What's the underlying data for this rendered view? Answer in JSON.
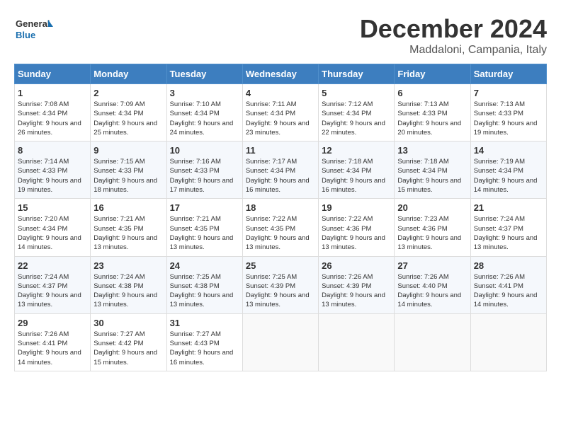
{
  "header": {
    "logo_text_general": "General",
    "logo_text_blue": "Blue",
    "month": "December 2024",
    "location": "Maddaloni, Campania, Italy"
  },
  "columns": [
    "Sunday",
    "Monday",
    "Tuesday",
    "Wednesday",
    "Thursday",
    "Friday",
    "Saturday"
  ],
  "weeks": [
    [
      {
        "day": "1",
        "sunrise": "Sunrise: 7:08 AM",
        "sunset": "Sunset: 4:34 PM",
        "daylight": "Daylight: 9 hours and 26 minutes."
      },
      {
        "day": "2",
        "sunrise": "Sunrise: 7:09 AM",
        "sunset": "Sunset: 4:34 PM",
        "daylight": "Daylight: 9 hours and 25 minutes."
      },
      {
        "day": "3",
        "sunrise": "Sunrise: 7:10 AM",
        "sunset": "Sunset: 4:34 PM",
        "daylight": "Daylight: 9 hours and 24 minutes."
      },
      {
        "day": "4",
        "sunrise": "Sunrise: 7:11 AM",
        "sunset": "Sunset: 4:34 PM",
        "daylight": "Daylight: 9 hours and 23 minutes."
      },
      {
        "day": "5",
        "sunrise": "Sunrise: 7:12 AM",
        "sunset": "Sunset: 4:34 PM",
        "daylight": "Daylight: 9 hours and 22 minutes."
      },
      {
        "day": "6",
        "sunrise": "Sunrise: 7:13 AM",
        "sunset": "Sunset: 4:33 PM",
        "daylight": "Daylight: 9 hours and 20 minutes."
      },
      {
        "day": "7",
        "sunrise": "Sunrise: 7:13 AM",
        "sunset": "Sunset: 4:33 PM",
        "daylight": "Daylight: 9 hours and 19 minutes."
      }
    ],
    [
      {
        "day": "8",
        "sunrise": "Sunrise: 7:14 AM",
        "sunset": "Sunset: 4:33 PM",
        "daylight": "Daylight: 9 hours and 19 minutes."
      },
      {
        "day": "9",
        "sunrise": "Sunrise: 7:15 AM",
        "sunset": "Sunset: 4:33 PM",
        "daylight": "Daylight: 9 hours and 18 minutes."
      },
      {
        "day": "10",
        "sunrise": "Sunrise: 7:16 AM",
        "sunset": "Sunset: 4:33 PM",
        "daylight": "Daylight: 9 hours and 17 minutes."
      },
      {
        "day": "11",
        "sunrise": "Sunrise: 7:17 AM",
        "sunset": "Sunset: 4:34 PM",
        "daylight": "Daylight: 9 hours and 16 minutes."
      },
      {
        "day": "12",
        "sunrise": "Sunrise: 7:18 AM",
        "sunset": "Sunset: 4:34 PM",
        "daylight": "Daylight: 9 hours and 16 minutes."
      },
      {
        "day": "13",
        "sunrise": "Sunrise: 7:18 AM",
        "sunset": "Sunset: 4:34 PM",
        "daylight": "Daylight: 9 hours and 15 minutes."
      },
      {
        "day": "14",
        "sunrise": "Sunrise: 7:19 AM",
        "sunset": "Sunset: 4:34 PM",
        "daylight": "Daylight: 9 hours and 14 minutes."
      }
    ],
    [
      {
        "day": "15",
        "sunrise": "Sunrise: 7:20 AM",
        "sunset": "Sunset: 4:34 PM",
        "daylight": "Daylight: 9 hours and 14 minutes."
      },
      {
        "day": "16",
        "sunrise": "Sunrise: 7:21 AM",
        "sunset": "Sunset: 4:35 PM",
        "daylight": "Daylight: 9 hours and 13 minutes."
      },
      {
        "day": "17",
        "sunrise": "Sunrise: 7:21 AM",
        "sunset": "Sunset: 4:35 PM",
        "daylight": "Daylight: 9 hours and 13 minutes."
      },
      {
        "day": "18",
        "sunrise": "Sunrise: 7:22 AM",
        "sunset": "Sunset: 4:35 PM",
        "daylight": "Daylight: 9 hours and 13 minutes."
      },
      {
        "day": "19",
        "sunrise": "Sunrise: 7:22 AM",
        "sunset": "Sunset: 4:36 PM",
        "daylight": "Daylight: 9 hours and 13 minutes."
      },
      {
        "day": "20",
        "sunrise": "Sunrise: 7:23 AM",
        "sunset": "Sunset: 4:36 PM",
        "daylight": "Daylight: 9 hours and 13 minutes."
      },
      {
        "day": "21",
        "sunrise": "Sunrise: 7:24 AM",
        "sunset": "Sunset: 4:37 PM",
        "daylight": "Daylight: 9 hours and 13 minutes."
      }
    ],
    [
      {
        "day": "22",
        "sunrise": "Sunrise: 7:24 AM",
        "sunset": "Sunset: 4:37 PM",
        "daylight": "Daylight: 9 hours and 13 minutes."
      },
      {
        "day": "23",
        "sunrise": "Sunrise: 7:24 AM",
        "sunset": "Sunset: 4:38 PM",
        "daylight": "Daylight: 9 hours and 13 minutes."
      },
      {
        "day": "24",
        "sunrise": "Sunrise: 7:25 AM",
        "sunset": "Sunset: 4:38 PM",
        "daylight": "Daylight: 9 hours and 13 minutes."
      },
      {
        "day": "25",
        "sunrise": "Sunrise: 7:25 AM",
        "sunset": "Sunset: 4:39 PM",
        "daylight": "Daylight: 9 hours and 13 minutes."
      },
      {
        "day": "26",
        "sunrise": "Sunrise: 7:26 AM",
        "sunset": "Sunset: 4:39 PM",
        "daylight": "Daylight: 9 hours and 13 minutes."
      },
      {
        "day": "27",
        "sunrise": "Sunrise: 7:26 AM",
        "sunset": "Sunset: 4:40 PM",
        "daylight": "Daylight: 9 hours and 14 minutes."
      },
      {
        "day": "28",
        "sunrise": "Sunrise: 7:26 AM",
        "sunset": "Sunset: 4:41 PM",
        "daylight": "Daylight: 9 hours and 14 minutes."
      }
    ],
    [
      {
        "day": "29",
        "sunrise": "Sunrise: 7:26 AM",
        "sunset": "Sunset: 4:41 PM",
        "daylight": "Daylight: 9 hours and 14 minutes."
      },
      {
        "day": "30",
        "sunrise": "Sunrise: 7:27 AM",
        "sunset": "Sunset: 4:42 PM",
        "daylight": "Daylight: 9 hours and 15 minutes."
      },
      {
        "day": "31",
        "sunrise": "Sunrise: 7:27 AM",
        "sunset": "Sunset: 4:43 PM",
        "daylight": "Daylight: 9 hours and 16 minutes."
      },
      null,
      null,
      null,
      null
    ]
  ]
}
